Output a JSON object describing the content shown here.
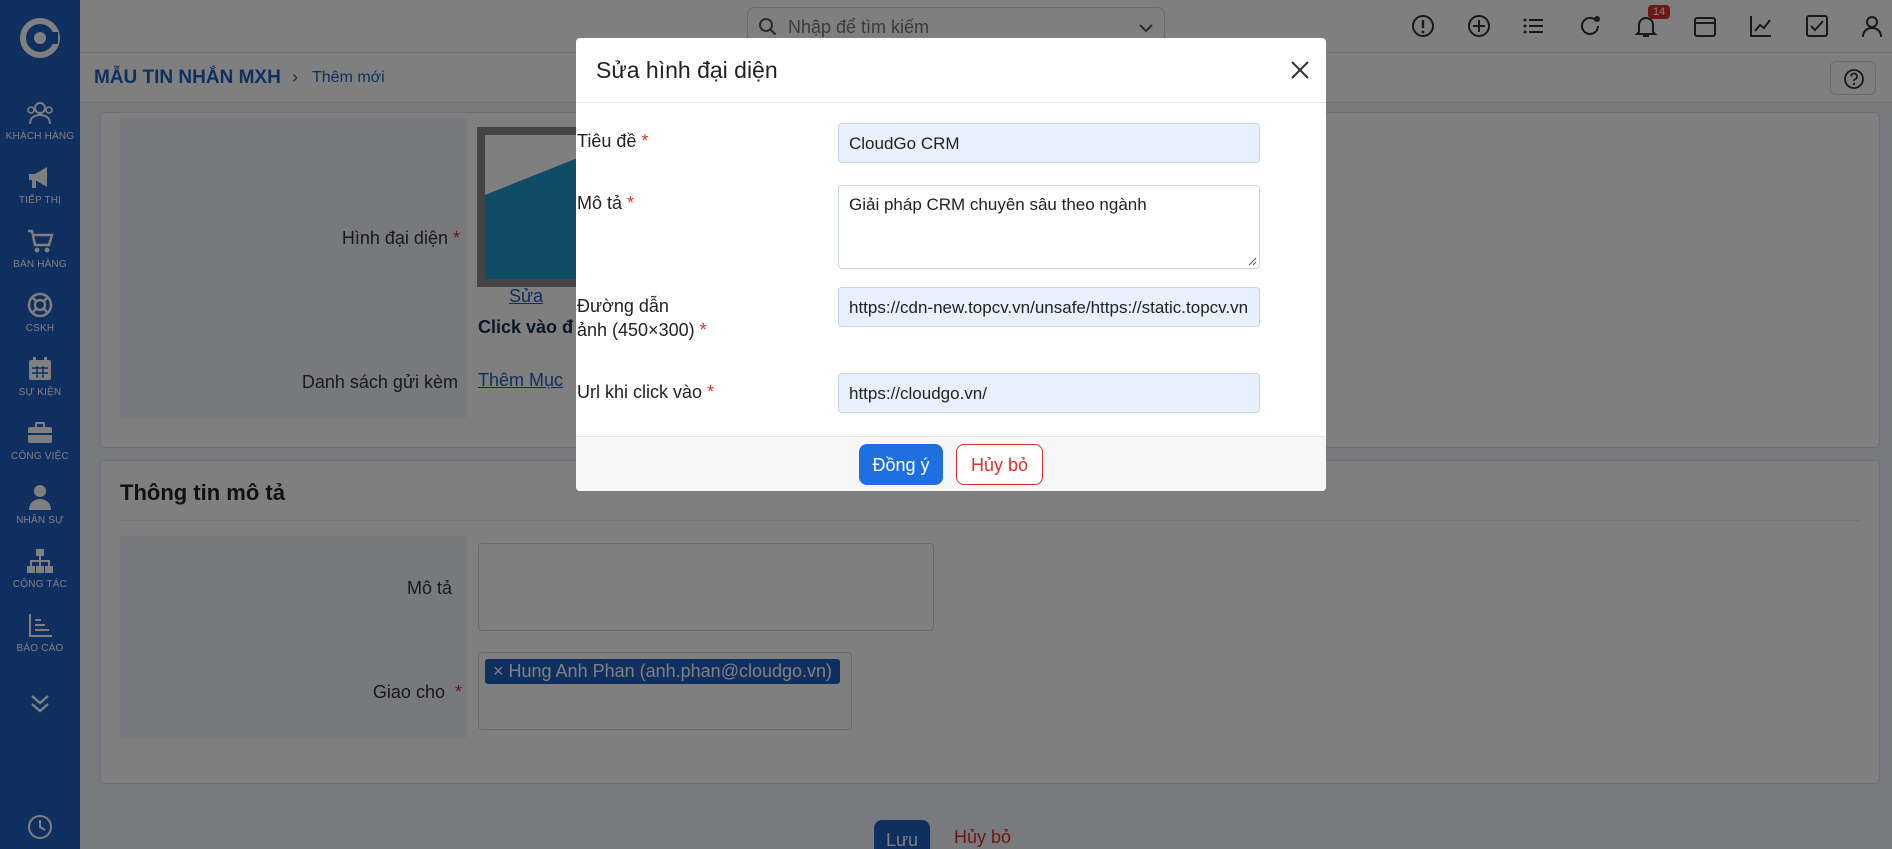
{
  "sidebar": {
    "items": [
      {
        "label": "KHÁCH HÀNG",
        "icon": "customers-icon"
      },
      {
        "label": "TIẾP THỊ",
        "icon": "megaphone-icon"
      },
      {
        "label": "BÁN HÀNG",
        "icon": "cart-icon"
      },
      {
        "label": "CSKH",
        "icon": "lifebuoy-icon"
      },
      {
        "label": "SỰ KIỆN",
        "icon": "calendar-icon"
      },
      {
        "label": "CÔNG VIỆC",
        "icon": "briefcase-icon"
      },
      {
        "label": "NHÂN SỰ",
        "icon": "person-icon"
      },
      {
        "label": "CỘNG TÁC",
        "icon": "org-chart-icon"
      },
      {
        "label": "BÁO CÁO",
        "icon": "report-icon"
      }
    ]
  },
  "search": {
    "placeholder": "Nhập để tìm kiếm"
  },
  "notifications": {
    "count": "14"
  },
  "breadcrumb": {
    "main": "MẪU TIN NHẮN MXH",
    "separator": "›",
    "current": "Thêm mới"
  },
  "form": {
    "avatar_label": "Hình đại diện",
    "edit_link": "Sửa",
    "click_hint": "Click vào đ",
    "attach_label": "Danh sách gửi kèm",
    "add_item_link": "Thêm Mục"
  },
  "description_section": {
    "title": "Thông tin mô tả",
    "desc_label": "Mô tả",
    "assign_label": "Giao cho",
    "assignee_chip": "× Hung Anh Phan (anh.phan@cloudgo.vn)"
  },
  "actions": {
    "save": "Lưu",
    "cancel": "Hủy bỏ"
  },
  "modal": {
    "title": "Sửa hình đại diện",
    "title_label": "Tiêu đề",
    "title_value": "CloudGo CRM",
    "desc_label": "Mô tả",
    "desc_value": "Giải pháp CRM chuyên sâu theo ngành",
    "image_label_line1": "Đường dẫn",
    "image_label_line2": "ảnh (450×300)",
    "image_value": "https://cdn-new.topcv.vn/unsafe/https://static.topcv.vn",
    "url_label": "Url khi click vào",
    "url_value": "https://cloudgo.vn/",
    "required_mark": "*",
    "ok": "Đồng ý",
    "cancel": "Hủy bỏ"
  },
  "colors": {
    "primary": "#1f5fc2",
    "danger": "#d9312b",
    "input_bg": "#e8f0fe"
  }
}
